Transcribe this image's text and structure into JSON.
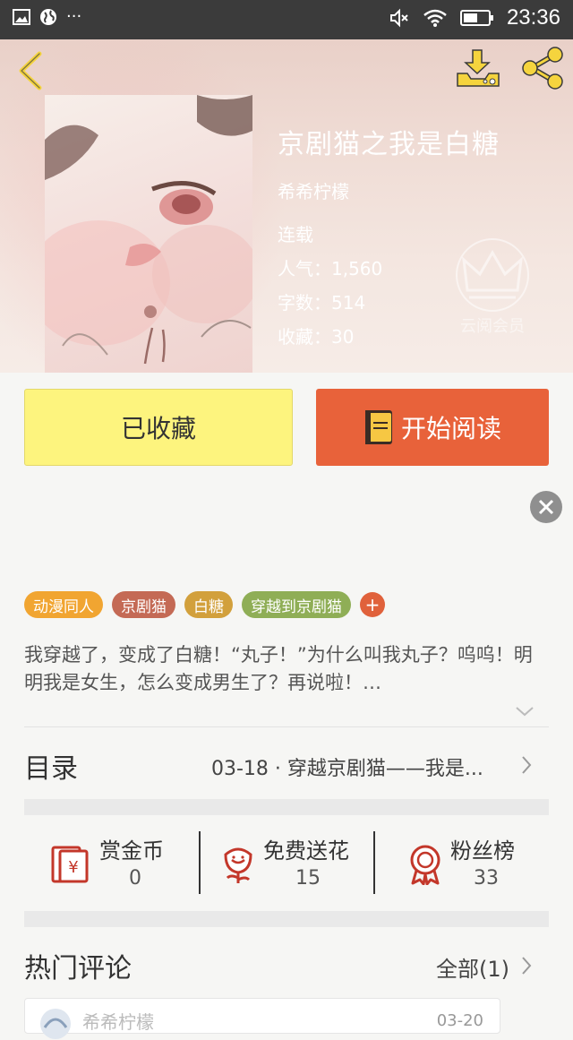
{
  "status_bar": {
    "time": "23:36",
    "dots": "···"
  },
  "book": {
    "title": "京剧猫之我是白糖",
    "author": "希希柠檬",
    "status": "连载",
    "popularity": "人气：1,560",
    "word_count": "字数：514",
    "favorites": "收藏：30",
    "watermark": "云阅会员"
  },
  "actions": {
    "collected": "已收藏",
    "start_reading": "开始阅读"
  },
  "tags": [
    "动漫同人",
    "京剧猫",
    "白糖",
    "穿越到京剧猫"
  ],
  "tag_add": "+",
  "description": "我穿越了，变成了白糖！“丸子！”为什么叫我丸子？呜呜！明明我是女生，怎么变成男生了？再说啦！…",
  "toc": {
    "label": "目录",
    "latest": "03-18 · 穿越京剧猫——我是..."
  },
  "stats": [
    {
      "label": "赏金币",
      "value": "0"
    },
    {
      "label": "免费送花",
      "value": "15"
    },
    {
      "label": "粉丝榜",
      "value": "33"
    }
  ],
  "hot_comments": {
    "label": "热门评论",
    "all": "全部(1)"
  },
  "comment_preview": {
    "name": "希希柠檬",
    "time": "03-20"
  },
  "colors": {
    "accent_orange": "#e8623a",
    "accent_yellow": "#fdf47e",
    "status_bar": "#3b3b3b"
  }
}
